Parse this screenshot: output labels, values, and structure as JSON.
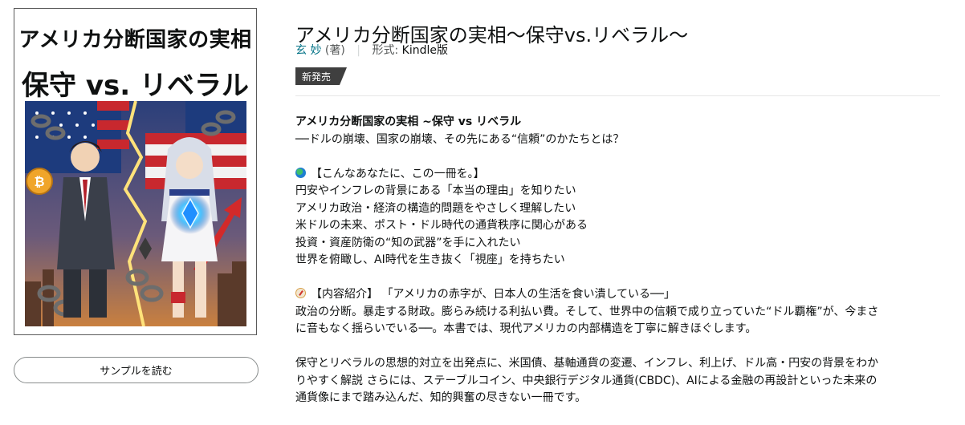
{
  "cover": {
    "title_line1": "アメリカ分断国家の実相",
    "title_line2": "保守 vs. リベラル"
  },
  "sample_button": "サンプルを読む",
  "product": {
    "title": "アメリカ分断国家の実相〜保守vs.リベラル〜",
    "author": "玄 妙",
    "author_role": "(著)",
    "format_label": "形式:",
    "format_value": "Kindle版",
    "badge": "新発売"
  },
  "description": {
    "heading": "アメリカ分断国家の実相 ~保守 vs リベラル",
    "subheading": "──ドルの崩壊、国家の崩壊、その先にある“信頼”のかたちとは？",
    "section1_title": "【こんなあなたに、この一冊を。】",
    "section1_items": [
      "円安やインフレの背景にある「本当の理由」を知りたい",
      "アメリカ政治・経済の構造的問題をやさしく理解したい",
      "米ドルの未来、ポスト・ドル時代の通貨秩序に関心がある",
      "投資・資産防衛の“知の武器”を手に入れたい",
      "世界を俯瞰し、AI時代を生き抜く「視座」を持ちたい"
    ],
    "section2_title": "【内容紹介】 「アメリカの赤字が、日本人の生活を食い潰している──」",
    "paragraph1_line1": "政治の分断。暴走する財政。膨らみ続ける利払い費。そして、世界中の信頼で成り立っていた“ドル覇権”が、今まさ",
    "paragraph1_line2": "に音もなく揺らいでいる──。本書では、現代アメリカの内部構造を丁寧に解きほぐします。",
    "paragraph2_line1": "保守とリベラルの思想的対立を出発点に、米国債、基軸通貨の変遷、インフレ、利上げ、ドル高・円安の背景をわか",
    "paragraph2_line2": "りやすく解説 さらには、ステーブルコイン、中央銀行デジタル通貨(CBDC)、AIによる金融の再設計といった未来の",
    "paragraph2_line3": "通貨像にまで踏み込んだ、知的興奮の尽きない一冊です。"
  },
  "icons": {
    "section1": "globe-icon",
    "section2": "compass-icon"
  }
}
